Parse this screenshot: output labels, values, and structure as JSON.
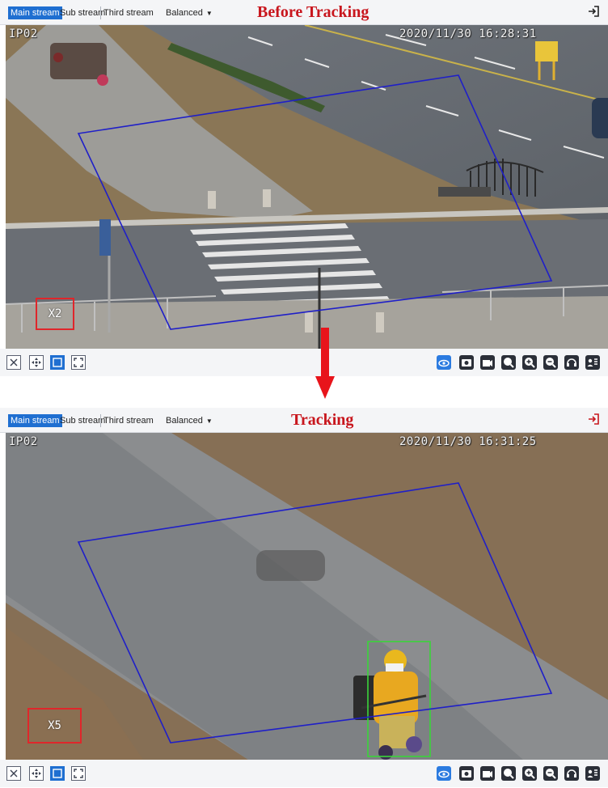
{
  "panels": [
    {
      "tabs": [
        "Main stream",
        "Sub stream",
        "Third stream"
      ],
      "active_tab": "Main stream",
      "quality": "Balanced",
      "title": "Before Tracking",
      "osd_camera": "IP02",
      "osd_datetime": "2020/11/30 16:28:31",
      "zoom_label": "X2"
    },
    {
      "tabs": [
        "Main stream",
        "Sub stream",
        "Third stream"
      ],
      "active_tab": "Main stream",
      "quality": "Balanced",
      "title": "Tracking",
      "osd_camera": "IP02",
      "osd_datetime": "2020/11/30 16:31:25",
      "zoom_label": "X5"
    }
  ],
  "left_controls": [
    "close-view-icon",
    "ptz-icon",
    "fit-window-icon",
    "fullscreen-icon"
  ],
  "right_controls": [
    "view-mode-icon",
    "snapshot-icon",
    "record-icon",
    "zoom-3d-icon",
    "zoom-in-icon",
    "zoom-out-icon",
    "talk-icon",
    "face-icon"
  ],
  "colors": {
    "accent": "#1f6fd1",
    "title_red": "#c8161d",
    "detection_region": "#1f1fc8",
    "tracked_box": "#3ad43a",
    "zoom_box": "#e0262b"
  }
}
